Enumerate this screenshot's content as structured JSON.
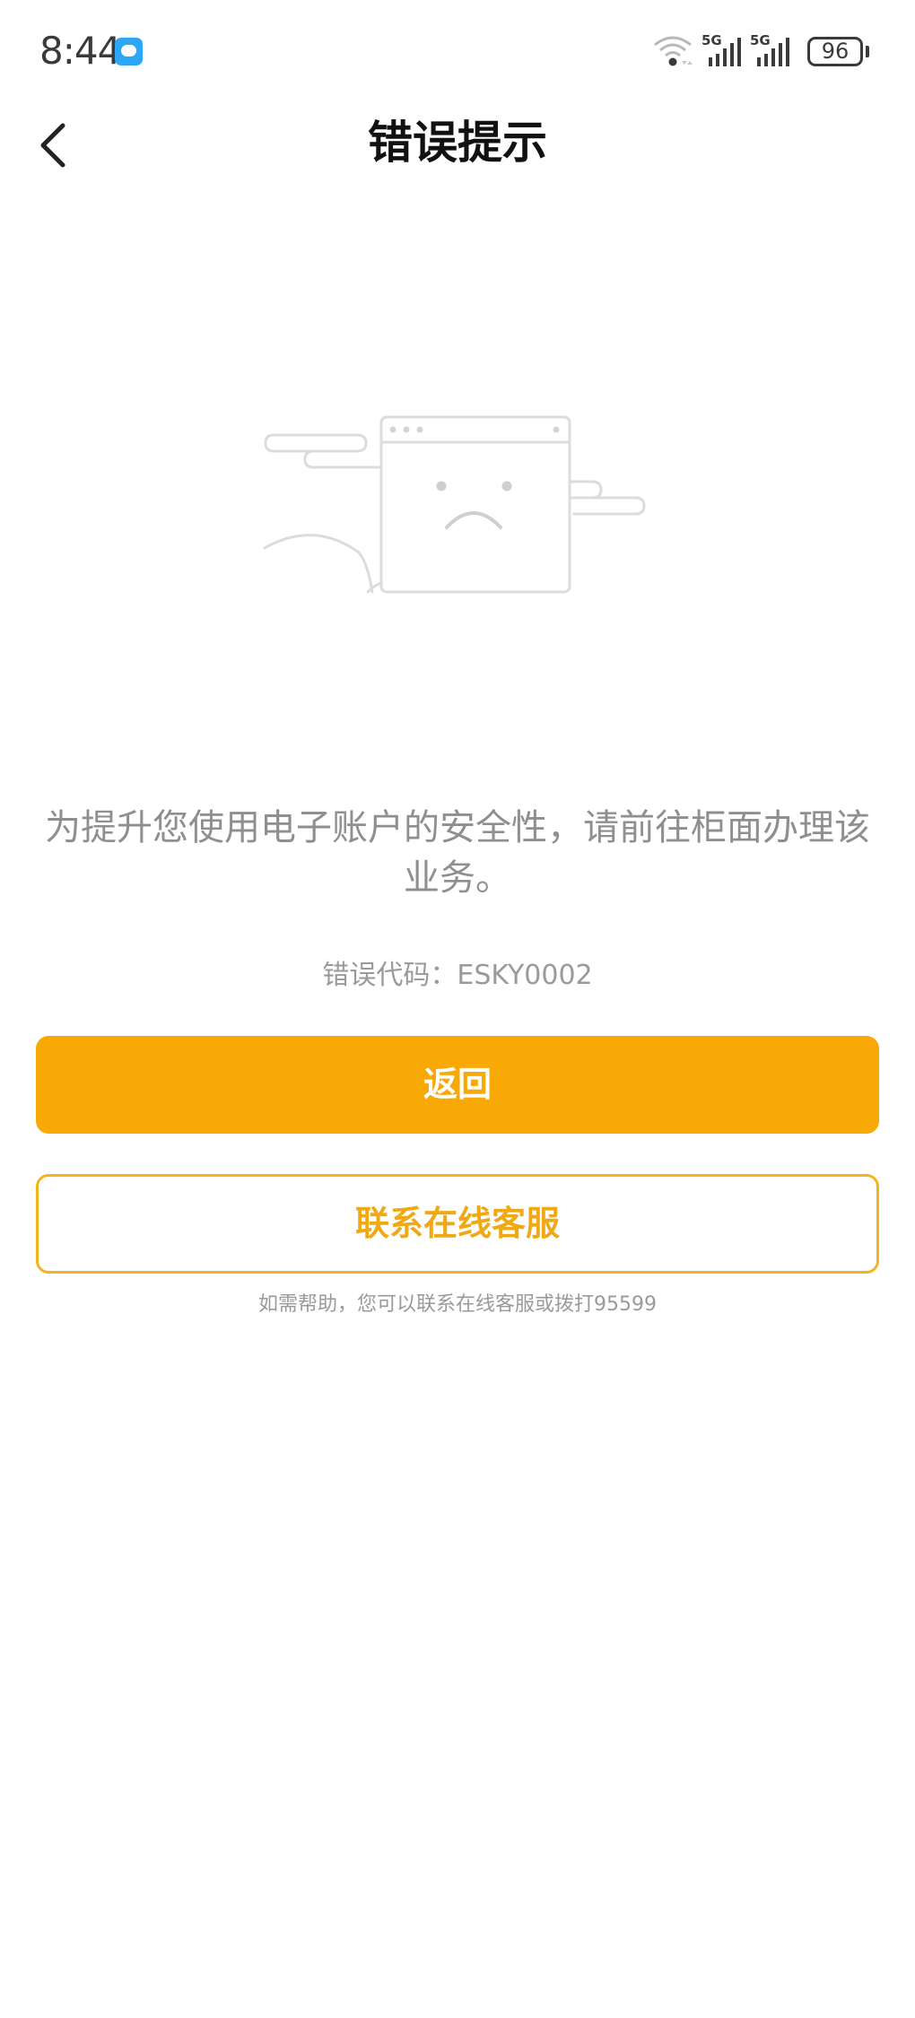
{
  "status_bar": {
    "time": "8:44",
    "network_1": "5G",
    "network_2": "5G",
    "battery": "96",
    "icons": [
      "message-app-icon",
      "wifi-icon",
      "signal-icon",
      "signal-icon",
      "battery-icon"
    ]
  },
  "nav": {
    "title": "错误提示",
    "back_icon": "chevron-left-icon"
  },
  "error": {
    "illustration": "sad-browser-window-illustration",
    "message": "为提升您使用电子账户的安全性，请前往柜面办理该业务。",
    "code_text": "错误代码：ESKY0002"
  },
  "actions": {
    "back_label": "返回",
    "contact_label": "联系在线客服"
  },
  "help": {
    "text": "如需帮助，您可以联系在线客服或拨打95599"
  },
  "colors": {
    "accent": "#f9a906",
    "accent_text": "#f0a914",
    "muted_text": "#8f8f8f"
  }
}
